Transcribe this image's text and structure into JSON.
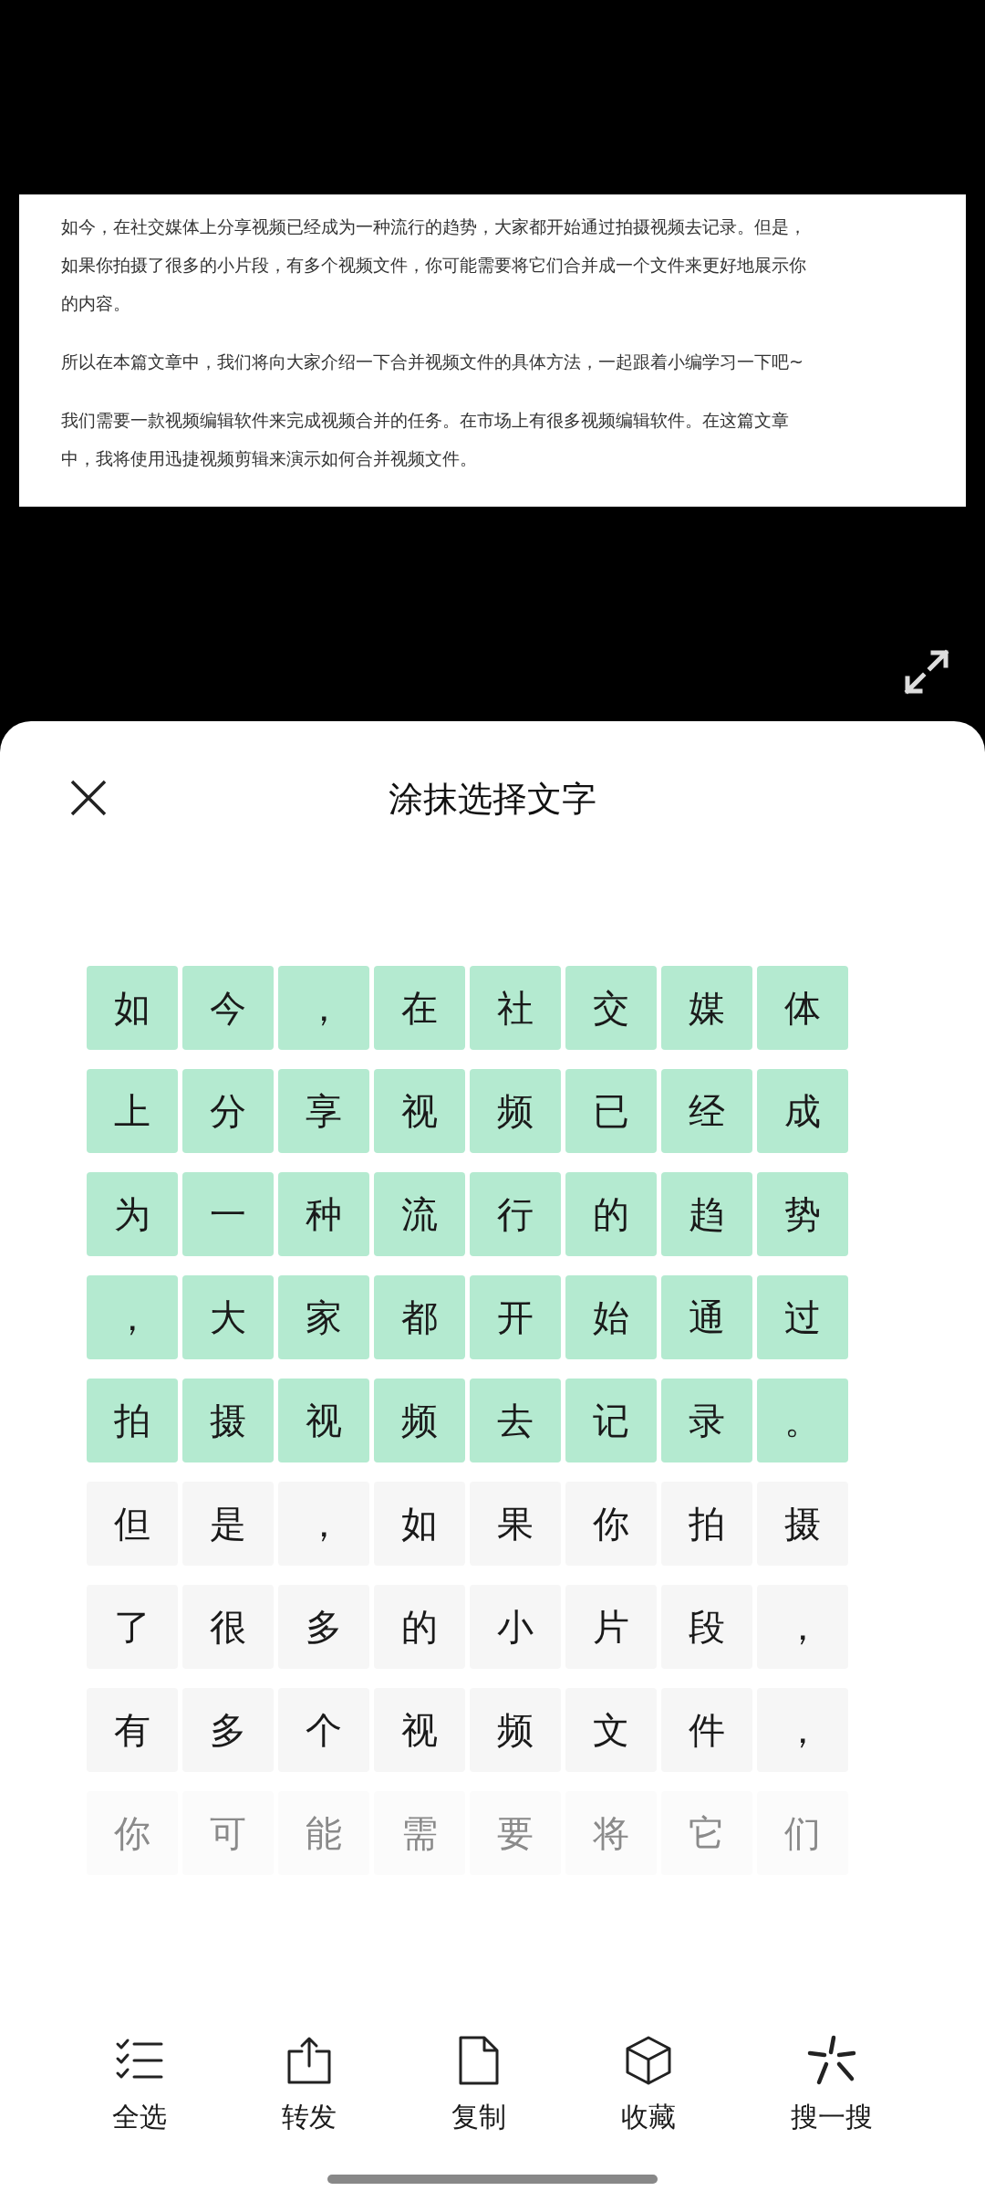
{
  "document": {
    "paragraphs": [
      {
        "lines": [
          "如今，在社交媒体上分享视频已经成为一种流行的趋势，大家都开始通过拍摄视频去记录。但是，",
          "如果你拍摄了很多的小片段，有多个视频文件，你可能需要将它们合并成一个文件来更好地展示你",
          "的内容。"
        ]
      },
      {
        "lines": [
          "所以在本篇文章中，我们将向大家介绍一下合并视频文件的具体方法，一起跟着小编学习一下吧~"
        ]
      },
      {
        "lines": [
          "我们需要一款视频编辑软件来完成视频合并的任务。在市场上有很多视频编辑软件。在这篇文章",
          "中，我将使用迅捷视频剪辑来演示如何合并视频文件。"
        ]
      }
    ]
  },
  "sheet": {
    "title": "涂抹选择文字",
    "rows": [
      {
        "faded": false,
        "cells": [
          {
            "char": "如",
            "selected": true
          },
          {
            "char": "今",
            "selected": true
          },
          {
            "char": "，",
            "selected": true
          },
          {
            "char": "在",
            "selected": true
          },
          {
            "char": "社",
            "selected": true
          },
          {
            "char": "交",
            "selected": true
          },
          {
            "char": "媒",
            "selected": true
          },
          {
            "char": "体",
            "selected": true
          }
        ]
      },
      {
        "faded": false,
        "cells": [
          {
            "char": "上",
            "selected": true
          },
          {
            "char": "分",
            "selected": true
          },
          {
            "char": "享",
            "selected": true
          },
          {
            "char": "视",
            "selected": true
          },
          {
            "char": "频",
            "selected": true
          },
          {
            "char": "已",
            "selected": true
          },
          {
            "char": "经",
            "selected": true
          },
          {
            "char": "成",
            "selected": true
          }
        ]
      },
      {
        "faded": false,
        "cells": [
          {
            "char": "为",
            "selected": true
          },
          {
            "char": "一",
            "selected": true
          },
          {
            "char": "种",
            "selected": true
          },
          {
            "char": "流",
            "selected": true
          },
          {
            "char": "行",
            "selected": true
          },
          {
            "char": "的",
            "selected": true
          },
          {
            "char": "趋",
            "selected": true
          },
          {
            "char": "势",
            "selected": true
          }
        ]
      },
      {
        "faded": false,
        "cells": [
          {
            "char": "，",
            "selected": true
          },
          {
            "char": "大",
            "selected": true
          },
          {
            "char": "家",
            "selected": true
          },
          {
            "char": "都",
            "selected": true
          },
          {
            "char": "开",
            "selected": true
          },
          {
            "char": "始",
            "selected": true
          },
          {
            "char": "通",
            "selected": true
          },
          {
            "char": "过",
            "selected": true
          }
        ]
      },
      {
        "faded": false,
        "cells": [
          {
            "char": "拍",
            "selected": true
          },
          {
            "char": "摄",
            "selected": true
          },
          {
            "char": "视",
            "selected": true
          },
          {
            "char": "频",
            "selected": true
          },
          {
            "char": "去",
            "selected": true
          },
          {
            "char": "记",
            "selected": true
          },
          {
            "char": "录",
            "selected": true
          },
          {
            "char": "。",
            "selected": true
          }
        ]
      },
      {
        "faded": false,
        "cells": [
          {
            "char": "但",
            "selected": false
          },
          {
            "char": "是",
            "selected": false
          },
          {
            "char": "，",
            "selected": false
          },
          {
            "char": "如",
            "selected": false
          },
          {
            "char": "果",
            "selected": false
          },
          {
            "char": "你",
            "selected": false
          },
          {
            "char": "拍",
            "selected": false
          },
          {
            "char": "摄",
            "selected": false
          }
        ]
      },
      {
        "faded": false,
        "cells": [
          {
            "char": "了",
            "selected": false
          },
          {
            "char": "很",
            "selected": false
          },
          {
            "char": "多",
            "selected": false
          },
          {
            "char": "的",
            "selected": false
          },
          {
            "char": "小",
            "selected": false
          },
          {
            "char": "片",
            "selected": false
          },
          {
            "char": "段",
            "selected": false
          },
          {
            "char": "，",
            "selected": false
          }
        ]
      },
      {
        "faded": false,
        "cells": [
          {
            "char": "有",
            "selected": false
          },
          {
            "char": "多",
            "selected": false
          },
          {
            "char": "个",
            "selected": false
          },
          {
            "char": "视",
            "selected": false
          },
          {
            "char": "频",
            "selected": false
          },
          {
            "char": "文",
            "selected": false
          },
          {
            "char": "件",
            "selected": false
          },
          {
            "char": "，",
            "selected": false
          }
        ]
      },
      {
        "faded": true,
        "cells": [
          {
            "char": "你",
            "selected": false
          },
          {
            "char": "可",
            "selected": false
          },
          {
            "char": "能",
            "selected": false
          },
          {
            "char": "需",
            "selected": false
          },
          {
            "char": "要",
            "selected": false
          },
          {
            "char": "将",
            "selected": false
          },
          {
            "char": "它",
            "selected": false
          },
          {
            "char": "们",
            "selected": false
          }
        ]
      }
    ],
    "actions": [
      {
        "kind": "select-all",
        "label": "全选"
      },
      {
        "kind": "share",
        "label": "转发"
      },
      {
        "kind": "copy",
        "label": "复制"
      },
      {
        "kind": "collect",
        "label": "收藏"
      },
      {
        "kind": "search",
        "label": "搜一搜"
      }
    ]
  }
}
